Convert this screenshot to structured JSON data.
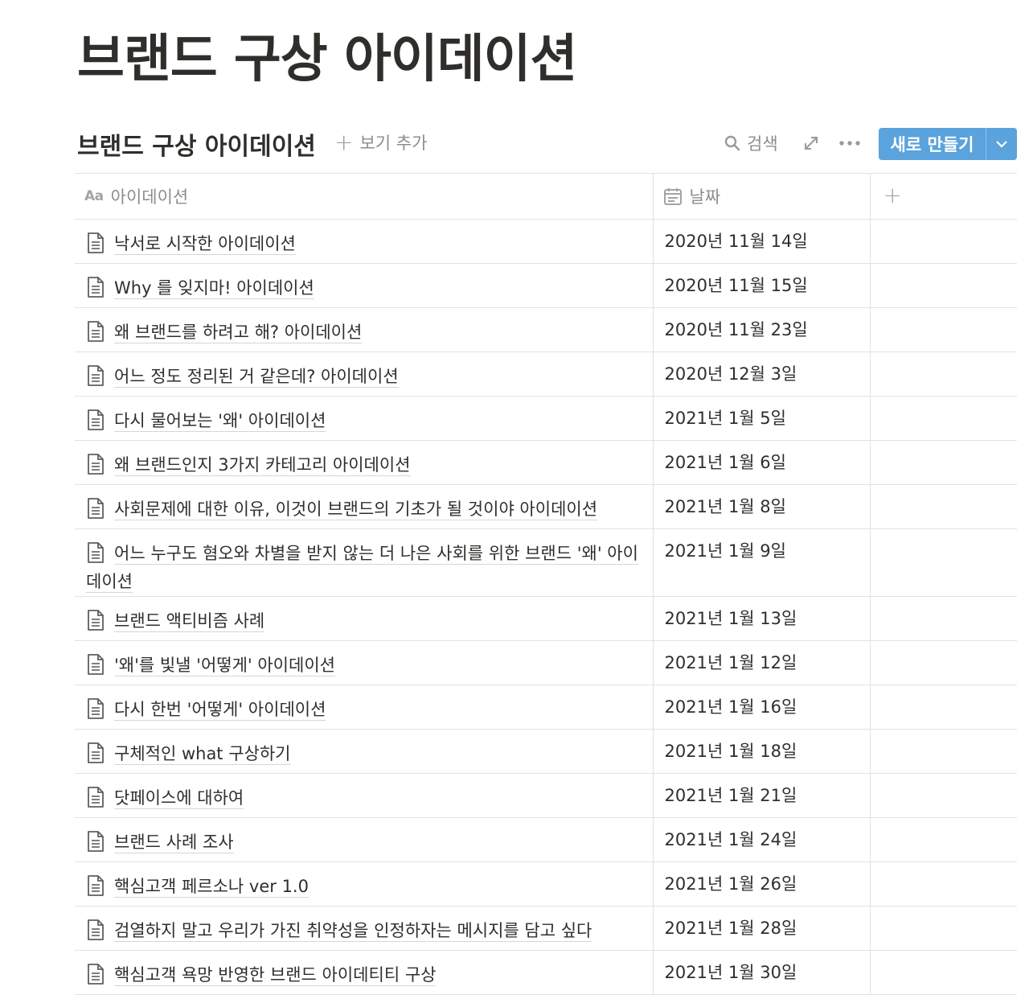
{
  "page": {
    "title": "브랜드 구상 아이데이션"
  },
  "database": {
    "title": "브랜드 구상 아이데이션",
    "add_view_label": "보기 추가",
    "search_label": "검색",
    "new_button_label": "새로 만들기",
    "accent_color": "#5aa3dc",
    "columns": {
      "name": "아이데이션",
      "name_type_icon": "Aa",
      "date": "날짜",
      "add": "+"
    },
    "rows": [
      {
        "name": "낙서로 시작한 아이데이션",
        "date": "2020년 11월 14일"
      },
      {
        "name": "Why 를 잊지마! 아이데이션",
        "date": "2020년 11월 15일"
      },
      {
        "name": "왜 브랜드를 하려고 해? 아이데이션",
        "date": "2020년 11월 23일"
      },
      {
        "name": "어느 정도 정리된 거 같은데? 아이데이션",
        "date": "2020년 12월 3일"
      },
      {
        "name": "다시 물어보는 '왜' 아이데이션",
        "date": "2021년 1월 5일"
      },
      {
        "name": "왜 브랜드인지 3가지 카테고리 아이데이션",
        "date": "2021년 1월 6일"
      },
      {
        "name": "사회문제에 대한 이유, 이것이 브랜드의 기초가 될 것이야 아이데이션",
        "date": "2021년 1월 8일"
      },
      {
        "name": "어느 누구도 혐오와 차별을 받지 않는 더 나은 사회를 위한 브랜드 '왜' 아이데이션",
        "date": "2021년 1월 9일"
      },
      {
        "name": "브랜드 액티비즘 사례",
        "date": "2021년 1월 13일"
      },
      {
        "name": "'왜'를 빛낼 '어떻게' 아이데이션",
        "date": "2021년 1월 12일"
      },
      {
        "name": "다시 한번 '어떻게' 아이데이션",
        "date": "2021년 1월 16일"
      },
      {
        "name": "구체적인 what 구상하기",
        "date": "2021년 1월 18일"
      },
      {
        "name": "닷페이스에 대하여",
        "date": "2021년 1월 21일"
      },
      {
        "name": "브랜드 사례 조사",
        "date": "2021년 1월 24일"
      },
      {
        "name": "핵심고객 페르소나 ver 1.0",
        "date": "2021년 1월 26일"
      },
      {
        "name": "검열하지 말고 우리가 가진 취약성을 인정하자는 메시지를 담고 싶다",
        "date": "2021년 1월 28일"
      },
      {
        "name": "핵심고객 욕망 반영한 브랜드 아이데티티 구상",
        "date": "2021년 1월 30일"
      }
    ]
  }
}
